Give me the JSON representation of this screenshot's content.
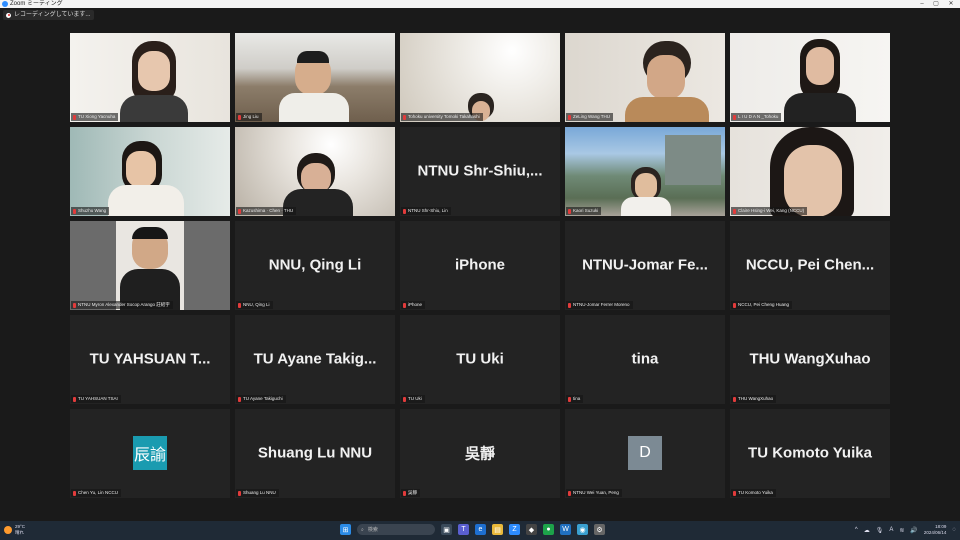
{
  "window": {
    "title": "Zoom ミーティング",
    "minimize": "–",
    "maximize": "▢",
    "close": "✕"
  },
  "recording": {
    "text": "レコーディングしています..."
  },
  "tiles": [
    {
      "name": "TU Xiong Yacnuha",
      "type": "video",
      "scene": "girl-glasses-white"
    },
    {
      "name": "Jing Liu",
      "type": "video",
      "scene": "classroom-man"
    },
    {
      "name": "Tohoku university Tomoki Takahashi",
      "type": "video",
      "scene": "small-head-bright"
    },
    {
      "name": "ZeLing Wang THU",
      "type": "video",
      "scene": "man-hand-cheek"
    },
    {
      "name": "L I U D A N _Tohoku",
      "type": "video",
      "scene": "woman-white-room"
    },
    {
      "name": "Shuzhu Wang",
      "type": "video",
      "scene": "woman-lab"
    },
    {
      "name": "Kazushima · Chen · THU",
      "type": "video",
      "scene": "man-lamp",
      "active": true
    },
    {
      "name": "NTNU Shr-Shiu, Lin",
      "big": "NTNU  Shr-Shiu,...",
      "type": "name"
    },
    {
      "name": "Kaori Suzuki",
      "type": "video",
      "scene": "woman-campus"
    },
    {
      "name": "Claire Hsing-i Wei, Kang (NCCU)",
      "type": "video",
      "scene": "woman-closeup"
    },
    {
      "name": "NTNU Myron Alexander Socop Arango 莊紹宇",
      "type": "video",
      "scene": "man-photo"
    },
    {
      "name": "NNU, Qing Li",
      "big": "NNU, Qing Li",
      "type": "name"
    },
    {
      "name": "iPhone",
      "big": "iPhone",
      "type": "name"
    },
    {
      "name": "NTNU-Jomar Ferrer Moreno",
      "big": "NTNU-Jomar  Fe...",
      "type": "name"
    },
    {
      "name": "NCCU, Pei Cheng Huang",
      "big": "NCCU,  Pei Chen...",
      "type": "name"
    },
    {
      "name": "TU YAHSUAN TSAI",
      "big": "TU  YAHSUAN  T...",
      "type": "name"
    },
    {
      "name": "TU Ayane Takiguchi",
      "big": "TU  Ayane  Takig...",
      "type": "name"
    },
    {
      "name": "TU Uki",
      "big": "TU Uki",
      "type": "name"
    },
    {
      "name": "tina",
      "big": "tina",
      "type": "name"
    },
    {
      "name": "THU WangXuhao",
      "big": "THU WangXuhao",
      "type": "name"
    },
    {
      "name": "Chen Yu, Lin NCCU",
      "avatar": "辰諭",
      "avatar_color": "#1a9bb0",
      "type": "avatar"
    },
    {
      "name": "Shuang Lu NNU",
      "big": "Shuang Lu NNU",
      "type": "name"
    },
    {
      "name": "吳靜",
      "big": "吳靜",
      "type": "name"
    },
    {
      "name": "NTNU Wei Yuan, Peng",
      "avatar": "D",
      "avatar_color": "#7c8a94",
      "type": "avatar"
    },
    {
      "name": "TU Komoto Yuika",
      "big": "TU Komoto Yuika",
      "type": "name"
    }
  ],
  "taskbar": {
    "weather_temp": "29°C",
    "weather_desc": "晴れ",
    "search_placeholder": "検索",
    "time": "18:09",
    "date": "2024/06/14",
    "tray_text": "A"
  }
}
